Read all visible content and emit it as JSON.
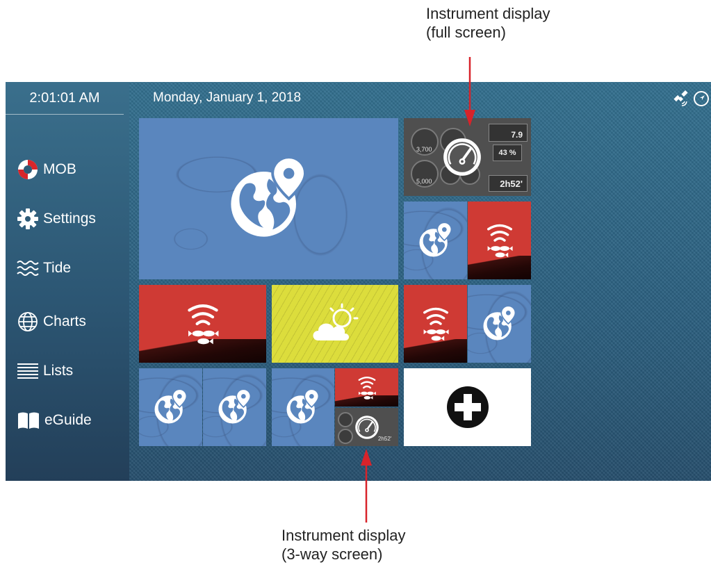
{
  "annotations": {
    "top_line1": "Instrument display",
    "top_line2": "(full screen)",
    "bottom_line1": "Instrument display",
    "bottom_line2": "(3-way screen)"
  },
  "sidebar": {
    "clock": "2:01:01 AM",
    "items": [
      {
        "label": "MOB",
        "icon": "lifebuoy-icon"
      },
      {
        "label": "Settings",
        "icon": "gear-icon"
      },
      {
        "label": "Tide",
        "icon": "waves-icon"
      },
      {
        "label": "Charts",
        "icon": "globe-icon"
      },
      {
        "label": "Lists",
        "icon": "list-icon"
      },
      {
        "label": "eGuide",
        "icon": "book-icon"
      }
    ]
  },
  "header": {
    "date": "Monday, January 1, 2018",
    "status_icons": [
      "satellite-icon",
      "navigation-icon"
    ]
  },
  "tiles": [
    {
      "id": "chart-large",
      "type": "chart"
    },
    {
      "id": "instrument-full",
      "type": "instrument"
    },
    {
      "id": "chart-sonar",
      "type": "chart+sonar"
    },
    {
      "id": "sonar",
      "type": "sonar"
    },
    {
      "id": "weather",
      "type": "weather"
    },
    {
      "id": "sonar-chart",
      "type": "sonar+chart"
    },
    {
      "id": "chart-chart",
      "type": "chart+chart"
    },
    {
      "id": "chart-sonar-instrument",
      "type": "chart+sonar+instrument"
    },
    {
      "id": "add",
      "type": "add"
    }
  ],
  "instrument_readouts": {
    "gauge_1": "3,700",
    "gauge_2": "5,000",
    "value_top": "7.9",
    "value_percent": "43 %",
    "value_time": "2h52'",
    "mini_value": "2h52'"
  },
  "colors": {
    "chart": "#5a86be",
    "sonar": "#cf3a34",
    "weather": "#dcdd3c",
    "instrument": "#4f4f4f",
    "annotation_arrow": "#d8232a"
  }
}
